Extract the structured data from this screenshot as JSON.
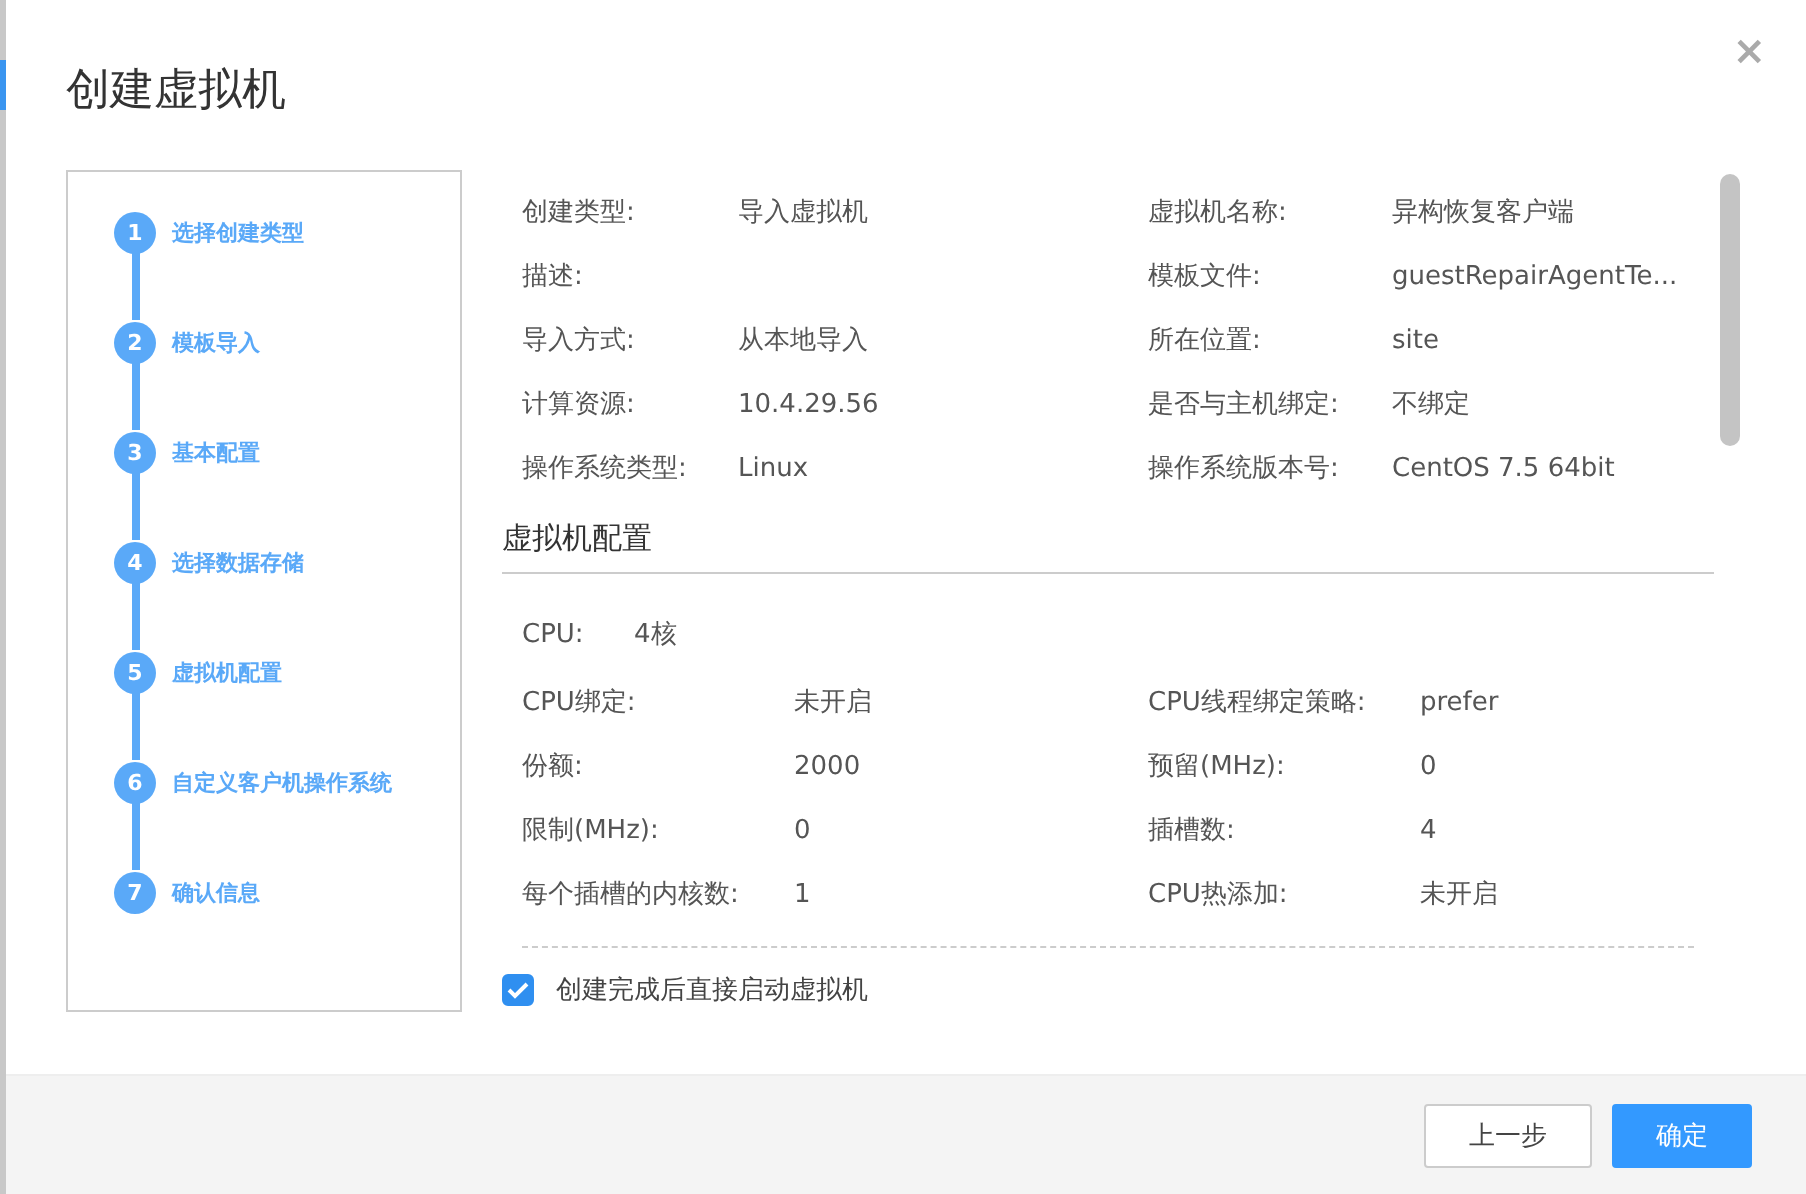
{
  "dialog": {
    "title": "创建虚拟机",
    "close": "×"
  },
  "steps": [
    {
      "number": "1",
      "label": "选择创建类型"
    },
    {
      "number": "2",
      "label": "模板导入"
    },
    {
      "number": "3",
      "label": "基本配置"
    },
    {
      "number": "4",
      "label": "选择数据存储"
    },
    {
      "number": "5",
      "label": "虚拟机配置"
    },
    {
      "number": "6",
      "label": "自定义客户机操作系统"
    },
    {
      "number": "7",
      "label": "确认信息"
    }
  ],
  "summary": [
    {
      "label": "创建类型:",
      "value": "导入虚拟机"
    },
    {
      "label": "虚拟机名称:",
      "value": "异构恢复客户端"
    },
    {
      "label": "描述:"
    },
    {
      "label": "模板文件:",
      "value": "guestRepairAgentTe..."
    },
    {
      "label": "导入方式:",
      "value": "从本地导入"
    },
    {
      "label": "所在位置:",
      "value": "site"
    },
    {
      "label": "计算资源:",
      "value": "10.4.29.56"
    },
    {
      "label": "是否与主机绑定:",
      "value": "不绑定"
    },
    {
      "label": "操作系统类型:",
      "value": "Linux"
    },
    {
      "label": "操作系统版本号:",
      "value": "CentOS 7.5 64bit"
    }
  ],
  "section": {
    "title": "虚拟机配置",
    "cpu_label": "CPU:",
    "cpu_value": "4核",
    "rows": [
      {
        "label": "CPU绑定:",
        "value": "未开启"
      },
      {
        "label": "CPU线程绑定策略:",
        "value": "prefer"
      },
      {
        "label": "份额:",
        "value": "2000"
      },
      {
        "label": "预留(MHz):",
        "value": "0"
      },
      {
        "label": "限制(MHz):",
        "value": "0"
      },
      {
        "label": "插槽数:",
        "value": "4"
      },
      {
        "label": "每个插槽的内核数:",
        "value": "1"
      },
      {
        "label": "CPU热添加:",
        "value": "未开启"
      }
    ]
  },
  "start_after_create": {
    "label": "创建完成后直接启动虚拟机",
    "checked": true
  },
  "buttons": [
    {
      "label": "上一步",
      "kind": "secondary"
    },
    {
      "label": "确定",
      "kind": "primary"
    }
  ]
}
